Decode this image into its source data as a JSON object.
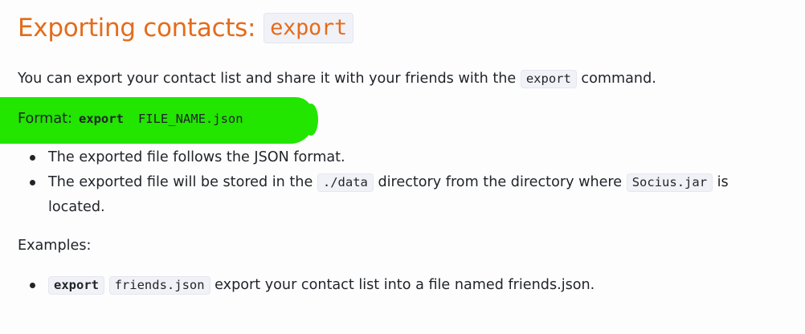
{
  "heading": {
    "text": "Exporting contacts:",
    "code": "export"
  },
  "intro": {
    "before": "You can export your contact list and share it with your friends with the",
    "code": "export",
    "after": "command."
  },
  "format": {
    "label": "Format:",
    "keyword": "export",
    "argument": "FILE_NAME.json",
    "highlight_color": "#22e500"
  },
  "notes": [
    {
      "text": "The exported file follows the JSON format."
    },
    {
      "before": "The exported file will be stored in the",
      "code1": "./data",
      "middle": "directory from the directory where",
      "code2": "Socius.jar",
      "after": "is located."
    }
  ],
  "examples": {
    "label": "Examples:",
    "items": [
      {
        "command": "export",
        "argument": "friends.json",
        "description": "export your contact list into a file named friends.json."
      }
    ]
  },
  "colors": {
    "heading": "#e46c1a",
    "text": "#212529",
    "code_background": "#f1f2f8"
  }
}
